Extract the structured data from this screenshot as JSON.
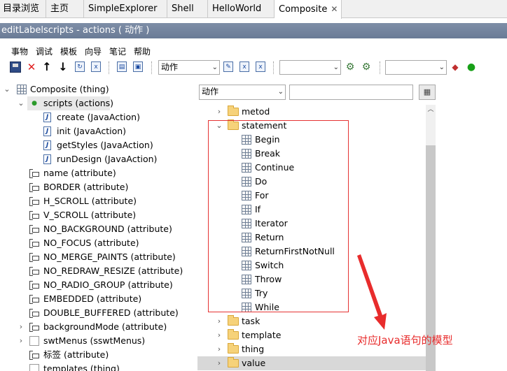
{
  "tabs": [
    {
      "label": "目录浏览",
      "active": false
    },
    {
      "label": "主页",
      "active": false
    },
    {
      "label": "SimpleExplorer",
      "active": false
    },
    {
      "label": "Shell",
      "active": false
    },
    {
      "label": "HelloWorld",
      "active": false
    },
    {
      "label": "Composite",
      "active": true
    }
  ],
  "window": {
    "title": "editLabelscripts - actions ( 动作 )"
  },
  "menu": [
    "事物",
    "调试",
    "模板",
    "向导",
    "笔记",
    "帮助"
  ],
  "toolbar": {
    "combo_main_value": "动作",
    "combo_2_value": "",
    "combo_3_value": ""
  },
  "left_tree": [
    {
      "label": "Composite (thing)",
      "icon": "table-icon",
      "expander": "expanded"
    },
    {
      "label": "scripts (actions)",
      "icon": "action-dot-icon",
      "expander": "expanded",
      "selected": true
    },
    {
      "label": "create (JavaAction)",
      "icon": "java-file-icon"
    },
    {
      "label": "init (JavaAction)",
      "icon": "java-file-icon"
    },
    {
      "label": "getStyles (JavaAction)",
      "icon": "java-file-icon"
    },
    {
      "label": "runDesign (JavaAction)",
      "icon": "java-file-icon"
    },
    {
      "label": "name (attribute)",
      "icon": "attribute-icon"
    },
    {
      "label": "BORDER (attribute)",
      "icon": "attribute-icon"
    },
    {
      "label": "H_SCROLL (attribute)",
      "icon": "attribute-icon"
    },
    {
      "label": "V_SCROLL (attribute)",
      "icon": "attribute-icon"
    },
    {
      "label": "NO_BACKGROUND (attribute)",
      "icon": "attribute-icon"
    },
    {
      "label": "NO_FOCUS (attribute)",
      "icon": "attribute-icon"
    },
    {
      "label": "NO_MERGE_PAINTS (attribute)",
      "icon": "attribute-icon"
    },
    {
      "label": "NO_REDRAW_RESIZE (attribute)",
      "icon": "attribute-icon"
    },
    {
      "label": "NO_RADIO_GROUP (attribute)",
      "icon": "attribute-icon"
    },
    {
      "label": "EMBEDDED (attribute)",
      "icon": "attribute-icon"
    },
    {
      "label": "DOUBLE_BUFFERED (attribute)",
      "icon": "attribute-icon"
    },
    {
      "label": "backgroundMode (attribute)",
      "icon": "attribute-icon",
      "expander": "collapsed"
    },
    {
      "label": "swtMenus (sswtMenus)",
      "icon": "plain-icon",
      "expander": "collapsed"
    },
    {
      "label": "标签 (attribute)",
      "icon": "attribute-icon"
    },
    {
      "label": "templates (thing)",
      "icon": "plain-icon"
    }
  ],
  "right_panel": {
    "filter_value": "动作",
    "search_value": "",
    "search_button_icon": "grid-search-icon",
    "tree": [
      {
        "label": "metod",
        "type": "folder",
        "expander": "collapsed"
      },
      {
        "label": "statement",
        "type": "folder",
        "expander": "expanded"
      },
      {
        "label": "Begin",
        "type": "item"
      },
      {
        "label": "Break",
        "type": "item"
      },
      {
        "label": "Continue",
        "type": "item"
      },
      {
        "label": "Do",
        "type": "item"
      },
      {
        "label": "For",
        "type": "item"
      },
      {
        "label": "If",
        "type": "item"
      },
      {
        "label": "Iterator",
        "type": "item"
      },
      {
        "label": "Return",
        "type": "item"
      },
      {
        "label": "ReturnFirstNotNull",
        "type": "item"
      },
      {
        "label": "Switch",
        "type": "item"
      },
      {
        "label": "Throw",
        "type": "item"
      },
      {
        "label": "Try",
        "type": "item"
      },
      {
        "label": "While",
        "type": "item"
      },
      {
        "label": "task",
        "type": "folder",
        "expander": "collapsed"
      },
      {
        "label": "template",
        "type": "folder",
        "expander": "collapsed"
      },
      {
        "label": "thing",
        "type": "folder",
        "expander": "collapsed"
      },
      {
        "label": "value",
        "type": "folder",
        "expander": "collapsed",
        "selected": true
      }
    ]
  },
  "annotation": {
    "text": "对应Java语句的模型",
    "color": "#e82c2c"
  }
}
